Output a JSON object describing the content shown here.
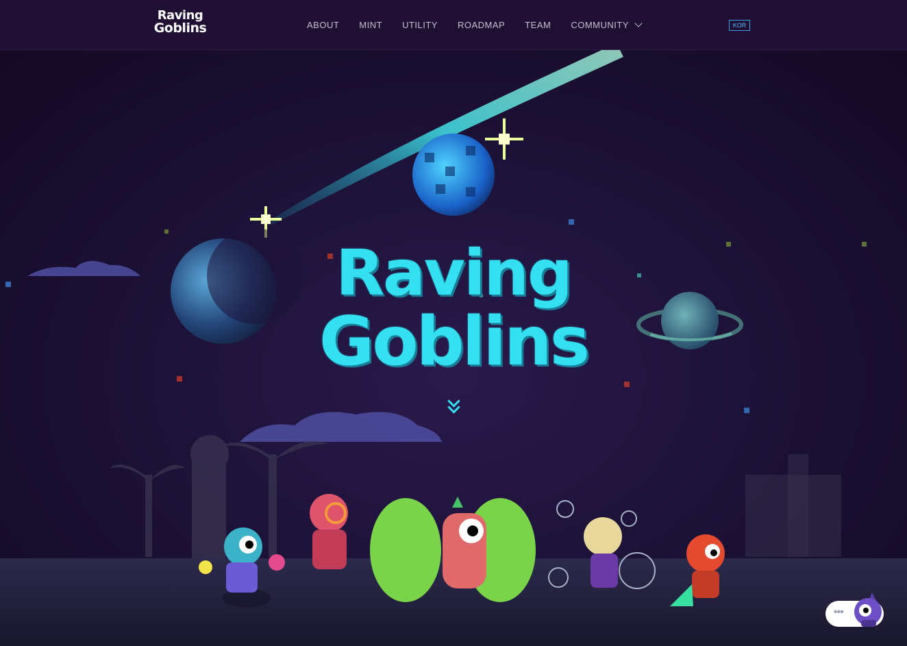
{
  "brand": {
    "logo_line1": "Raving",
    "logo_line2": "Goblins"
  },
  "nav": {
    "items": [
      {
        "label": "ABOUT"
      },
      {
        "label": "MINT"
      },
      {
        "label": "UTILITY"
      },
      {
        "label": "ROADMAP"
      },
      {
        "label": "TEAM"
      },
      {
        "label": "COMMUNITY",
        "has_dropdown": true
      }
    ],
    "lang_label": "KOR"
  },
  "hero": {
    "title_line1": "Raving",
    "title_line2": "Goblins"
  },
  "chat": {
    "dots": "•••"
  },
  "colors": {
    "nav_bg": "#1f1033",
    "hero_bg": "#1d1238",
    "title_cyan": "#35dff2",
    "lang_blue": "#54b6ff",
    "nav_text": "#c6c0d3"
  }
}
